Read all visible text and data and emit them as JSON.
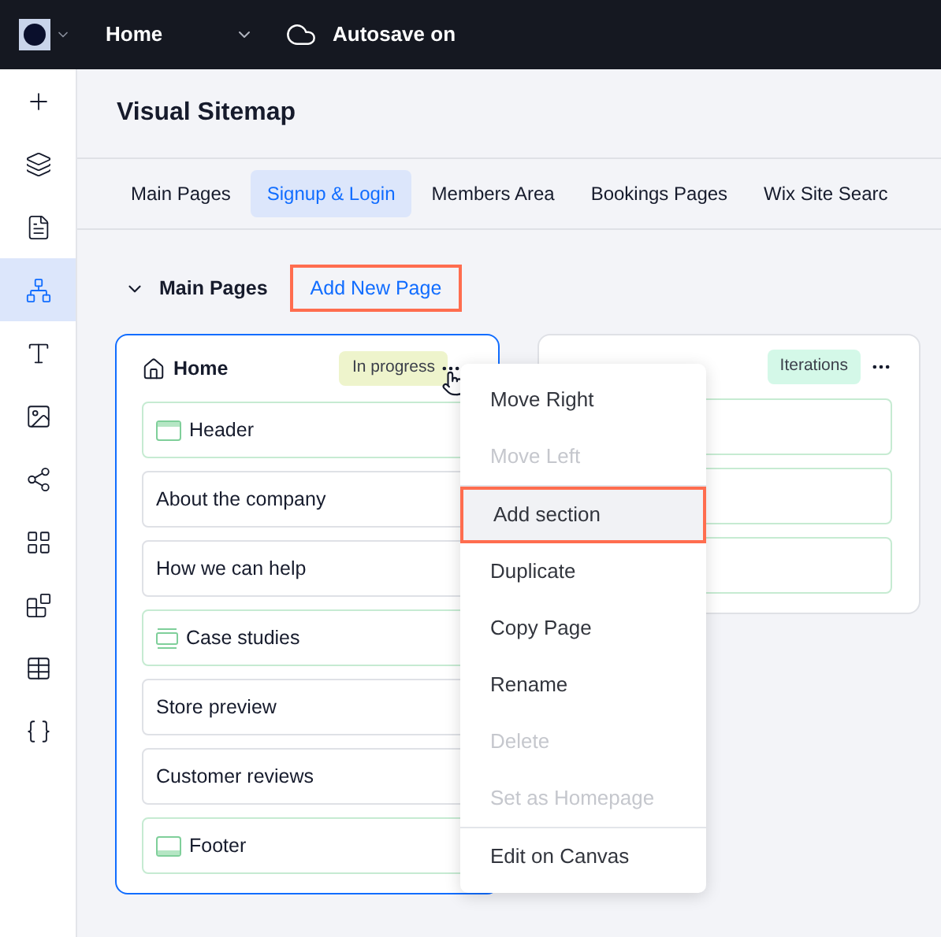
{
  "topbar": {
    "page_selector": "Home",
    "autosave": "Autosave on"
  },
  "sidebar": {
    "items": [
      {
        "kind": "add",
        "selected": false
      },
      {
        "kind": "layers",
        "selected": false
      },
      {
        "kind": "page",
        "selected": false
      },
      {
        "kind": "sitemap",
        "selected": true
      },
      {
        "kind": "text",
        "selected": false
      },
      {
        "kind": "image",
        "selected": false
      },
      {
        "kind": "apps",
        "selected": false
      },
      {
        "kind": "grid",
        "selected": false
      },
      {
        "kind": "puzzle",
        "selected": false
      },
      {
        "kind": "table",
        "selected": false
      },
      {
        "kind": "code",
        "selected": false
      }
    ]
  },
  "title": "Visual Sitemap",
  "tabs": [
    {
      "label": "Main Pages",
      "selected": false
    },
    {
      "label": "Signup & Login",
      "selected": true
    },
    {
      "label": "Members Area",
      "selected": false
    },
    {
      "label": "Bookings Pages",
      "selected": false
    },
    {
      "label": "Wix Site Searc",
      "selected": false
    }
  ],
  "group": {
    "title": "Main Pages",
    "expanded": true,
    "add_button": {
      "label": "Add New Page",
      "highlighted": true
    }
  },
  "pages": [
    {
      "title": "Home",
      "is_home": true,
      "selected": true,
      "status": {
        "label": "In progress",
        "color": "#eef4cc"
      },
      "sections": [
        {
          "kind": "header",
          "label": "Header"
        },
        {
          "kind": "plain",
          "label": "About the company"
        },
        {
          "kind": "plain",
          "label": "How we can help"
        },
        {
          "kind": "strip",
          "label": "Case studies"
        },
        {
          "kind": "plain",
          "label": "Store preview"
        },
        {
          "kind": "plain",
          "label": "Customer reviews"
        },
        {
          "kind": "footer",
          "label": "Footer"
        }
      ]
    },
    {
      "selected": false,
      "status": {
        "label": "Iterations",
        "color": "#d4f8e8"
      },
      "sections": [
        {
          "kind": "header"
        },
        {
          "kind": "strip"
        },
        {
          "kind": "footer"
        }
      ]
    }
  ],
  "context_menu": {
    "items": [
      {
        "label": "Move Right",
        "disabled": false,
        "highlighted": false,
        "divider_after": false
      },
      {
        "label": "Move Left",
        "disabled": true,
        "highlighted": false,
        "divider_after": true
      },
      {
        "label": "Add section",
        "disabled": false,
        "highlighted": true,
        "divider_after": false
      },
      {
        "label": "Duplicate",
        "disabled": false,
        "highlighted": false,
        "divider_after": false
      },
      {
        "label": "Copy Page",
        "disabled": false,
        "highlighted": false,
        "divider_after": false
      },
      {
        "label": "Rename",
        "disabled": false,
        "highlighted": false,
        "divider_after": false
      },
      {
        "label": "Delete",
        "disabled": true,
        "highlighted": false,
        "divider_after": false
      },
      {
        "label": "Set as Homepage",
        "disabled": true,
        "highlighted": false,
        "divider_after": true
      },
      {
        "label": "Edit on Canvas",
        "disabled": false,
        "highlighted": false,
        "divider_after": false
      }
    ]
  }
}
